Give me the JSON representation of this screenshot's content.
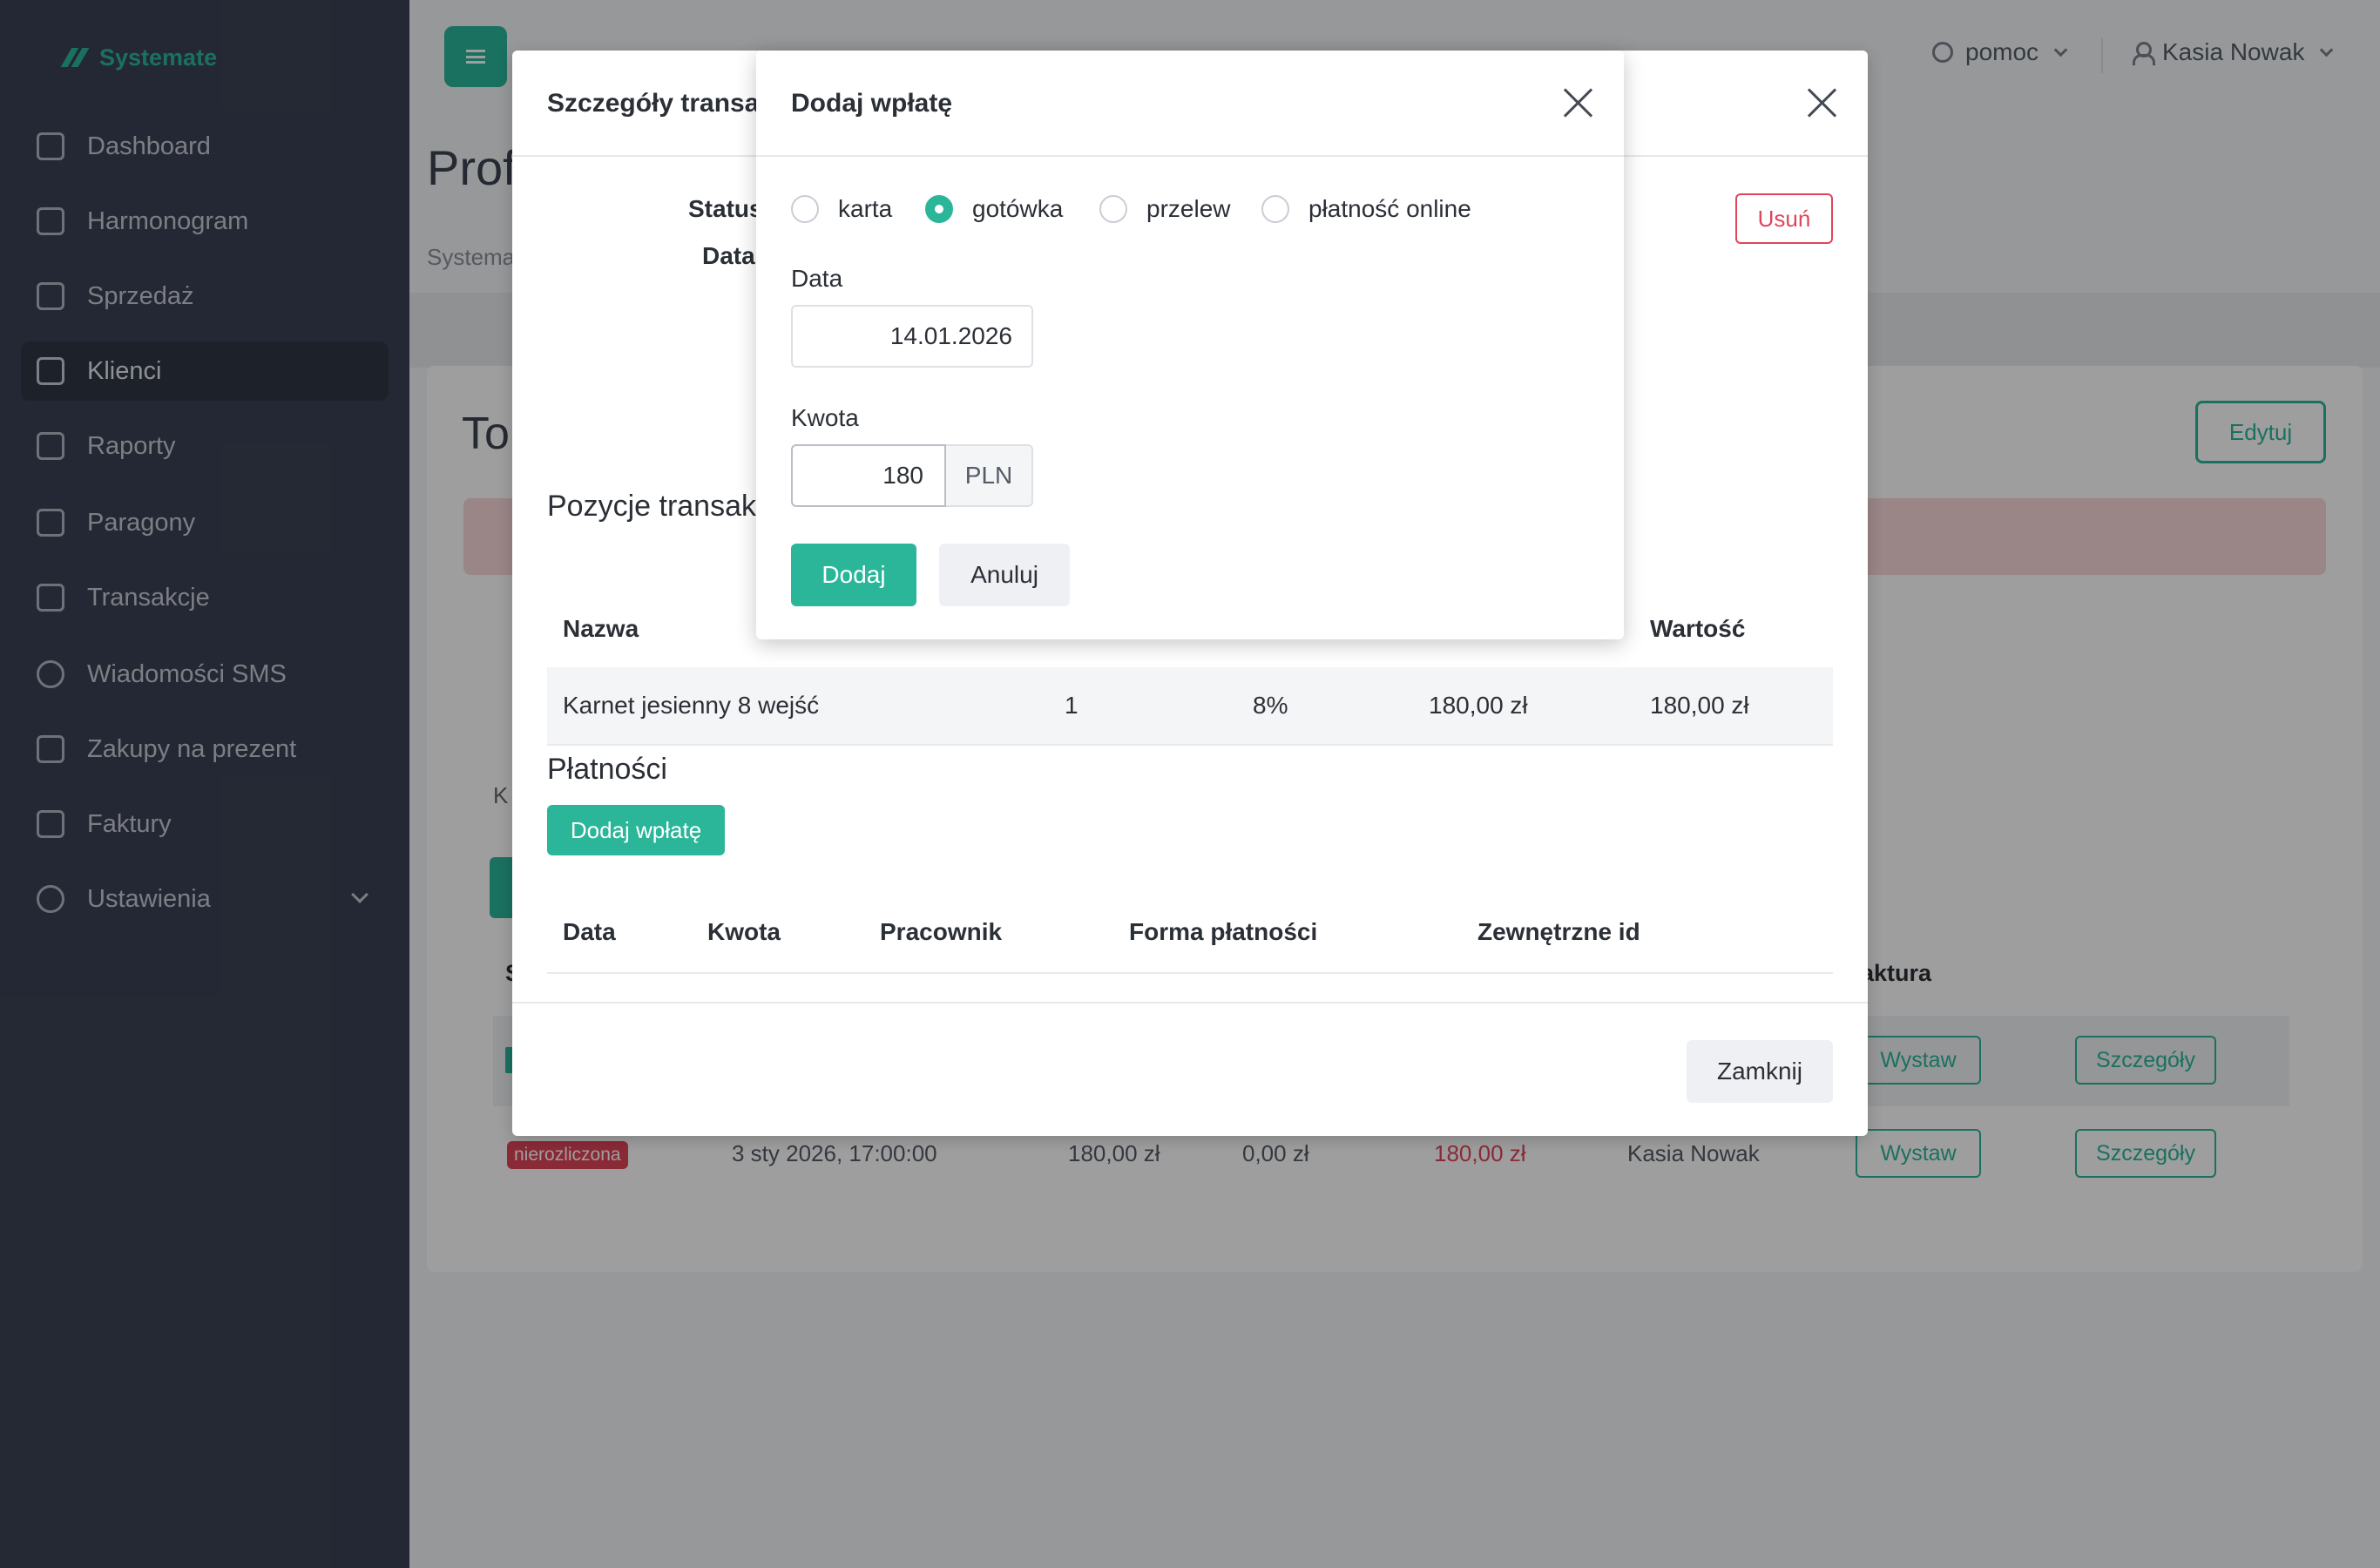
{
  "sidebar": {
    "brand": "Systemate",
    "items": [
      {
        "label": "Dashboard",
        "icon": "home-icon"
      },
      {
        "label": "Harmonogram",
        "icon": "calendar-icon"
      },
      {
        "label": "Sprzedaż",
        "icon": "basket-icon"
      },
      {
        "label": "Klienci",
        "icon": "contacts-icon"
      },
      {
        "label": "Raporty",
        "icon": "chart-icon"
      },
      {
        "label": "Paragony",
        "icon": "receipt-icon"
      },
      {
        "label": "Transakcje",
        "icon": "list-icon"
      },
      {
        "label": "Wiadomości SMS",
        "icon": "chat-icon"
      },
      {
        "label": "Zakupy na prezent",
        "icon": "gift-icon"
      },
      {
        "label": "Faktury",
        "icon": "document-icon"
      },
      {
        "label": "Ustawienia",
        "icon": "settings-icon"
      }
    ]
  },
  "topbar": {
    "help_label": "pomoc",
    "user_name": "Kasia Nowak"
  },
  "background_page": {
    "title": "Profi",
    "breadcrumb": "Systema",
    "card_title": "To",
    "edit_label": "Edytuj",
    "k_label": "K",
    "s_header": "S",
    "faktura_header": "aktura",
    "row1": {
      "issue_label": "Wystaw",
      "details_label": "Szczegóły"
    },
    "row2": {
      "status": "nierozliczona",
      "date": "3 sty 2026, 17:00:00",
      "amount": "180,00 zł",
      "paid": "0,00 zł",
      "due": "180,00 zł",
      "employee": "Kasia Nowak",
      "issue_label": "Wystaw",
      "details_label": "Szczegóły"
    }
  },
  "transaction_modal": {
    "title": "Szczegóły transak",
    "status_label": "Status",
    "date_label": "Data",
    "delete_label": "Usuń",
    "items_title": "Pozycje transak",
    "items_headers": {
      "name": "Nazwa",
      "value": "Wartość"
    },
    "items": [
      {
        "name": "Karnet jesienny 8 wejść",
        "qty": "1",
        "vat": "8%",
        "price": "180,00 zł",
        "value": "180,00 zł"
      }
    ],
    "payments_title": "Płatności",
    "add_payment_label": "Dodaj wpłatę",
    "payments_headers": {
      "date": "Data",
      "amount": "Kwota",
      "employee": "Pracownik",
      "method": "Forma płatności",
      "external_id": "Zewnętrzne id"
    },
    "close_label": "Zamknij"
  },
  "payment_modal": {
    "title": "Dodaj wpłatę",
    "methods": [
      {
        "label": "karta",
        "checked": false
      },
      {
        "label": "gotówka",
        "checked": true
      },
      {
        "label": "przelew",
        "checked": false
      },
      {
        "label": "płatność online",
        "checked": false
      }
    ],
    "date_label": "Data",
    "date_value": "14.01.2026",
    "amount_label": "Kwota",
    "amount_value": "180",
    "currency": "PLN",
    "submit_label": "Dodaj",
    "cancel_label": "Anuluj"
  },
  "colors": {
    "accent": "#2bb69a",
    "danger": "#e0455a",
    "sidebar_bg": "#3a4254"
  }
}
